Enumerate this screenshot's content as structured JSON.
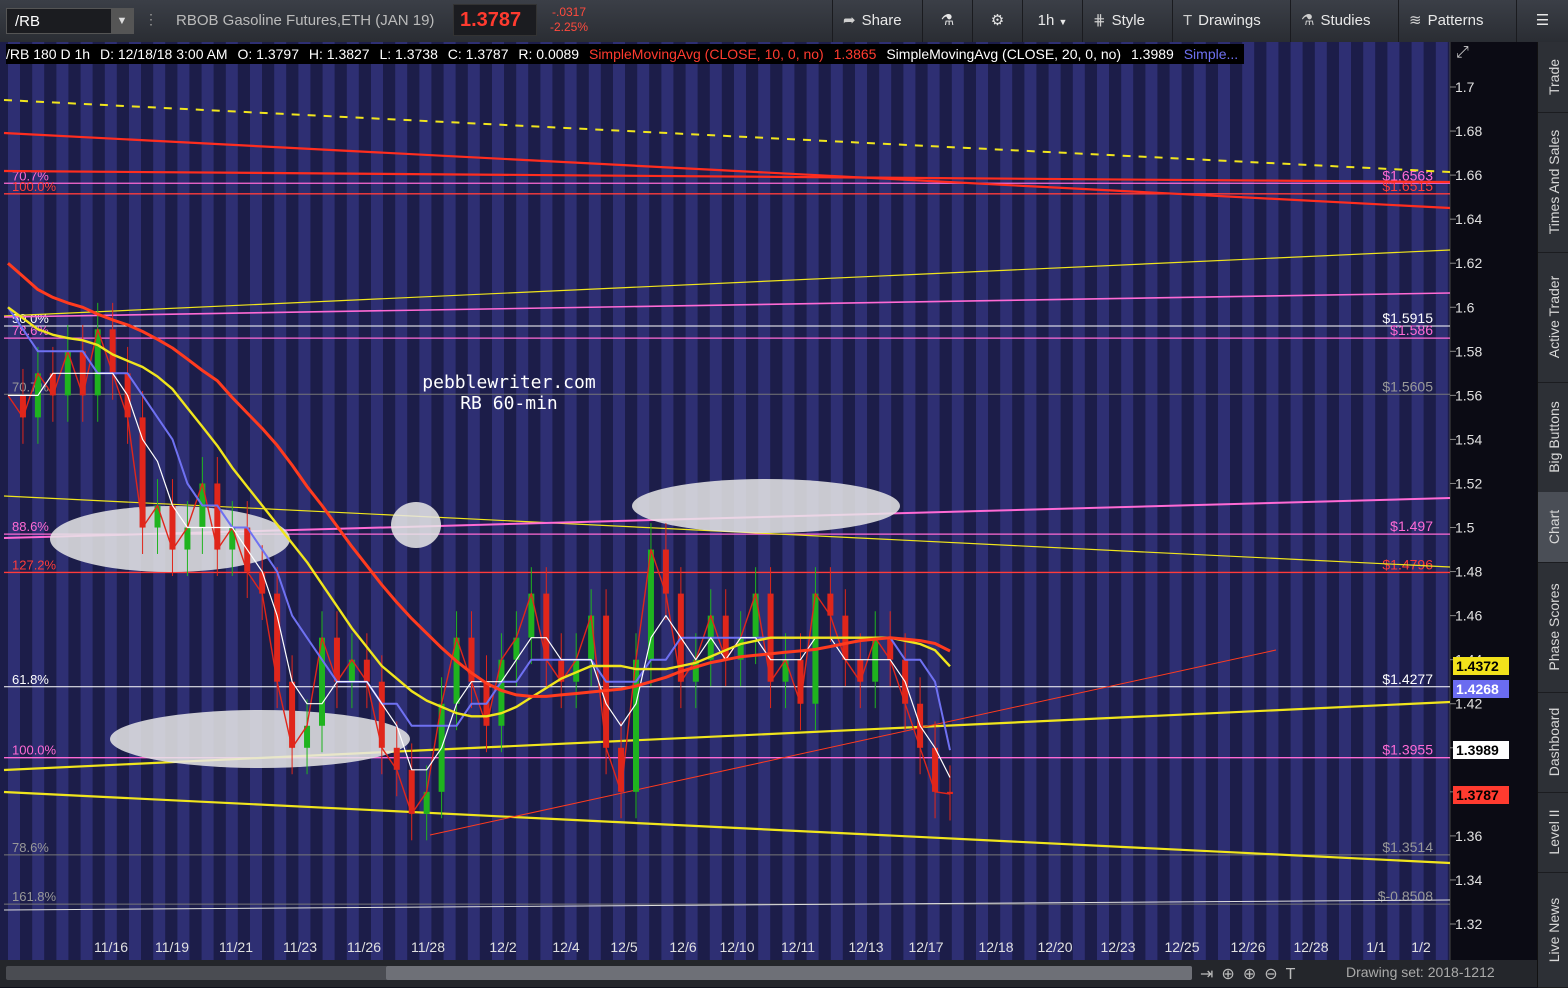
{
  "toolbar": {
    "symbol": "/RB",
    "description": "RBOB Gasoline Futures,ETH (JAN 19)",
    "last_price": "1.3787",
    "change": "-.0317",
    "change_pct": "-2.25%",
    "share": "Share",
    "timeframe": "1h",
    "style": "Style",
    "drawings": "Drawings",
    "studies": "Studies",
    "patterns": "Patterns"
  },
  "header": {
    "symbol_info": "/RB 180 D 1h",
    "date": "D: 12/18/18 3:00 AM",
    "open": "O: 1.3797",
    "high": "H: 1.3827",
    "low": "L: 1.3738",
    "close": "C: 1.3787",
    "range": "R: 0.0089",
    "sma10_label": "SimpleMovingAvg (CLOSE, 10, 0, no)",
    "sma10_value": "1.3865",
    "sma20_label": "SimpleMovingAvg (CLOSE, 20, 0, no)",
    "sma20_value": "1.3989",
    "more": "Simple..."
  },
  "watermark": {
    "line1": "pebblewriter.com",
    "line2": "RB 60-min"
  },
  "side_tabs": [
    "Trade",
    "Times And Sales",
    "Active Trader",
    "Big Buttons",
    "Chart",
    "Phase Scores",
    "Dashboard",
    "Level II",
    "Live News"
  ],
  "bottom": {
    "drawing_set": "Drawing set: 2018-1212"
  },
  "chart_data": {
    "type": "line",
    "ylim": [
      1.31,
      1.72
    ],
    "y_ticks": [
      "1.7",
      "1.68",
      "1.66",
      "1.64",
      "1.62",
      "1.6",
      "1.58",
      "1.56",
      "1.54",
      "1.52",
      "1.5",
      "1.48",
      "1.46",
      "1.44",
      "1.42",
      "1.4",
      "1.38",
      "1.36",
      "1.34",
      "1.32"
    ],
    "x_ticks": [
      "11/16",
      "11/19",
      "11/21",
      "11/23",
      "11/26",
      "11/28",
      "12/2",
      "12/4",
      "12/5",
      "12/6",
      "12/10",
      "12/11",
      "12/13",
      "12/17",
      "12/18",
      "12/20",
      "12/23",
      "12/25",
      "12/26",
      "12/28",
      "1/1",
      "1/2"
    ],
    "fib_levels": [
      {
        "left": "70.7%",
        "right": "$1.6563",
        "value": 1.6563,
        "color": "#ff6ad5"
      },
      {
        "left": "100.0%",
        "right": "$1.6515",
        "value": 1.6515,
        "color": "#ff3b3b"
      },
      {
        "left": "50.0%",
        "right": "$1.5915",
        "value": 1.5915,
        "color": "#ffffff"
      },
      {
        "left": "78.6%",
        "right": "$1.586",
        "value": 1.586,
        "color": "#ff6ad5"
      },
      {
        "left": "70.7%",
        "right": "$1.5605",
        "value": 1.5605,
        "color": "#777777"
      },
      {
        "left": "88.6%",
        "right": "$1.497",
        "value": 1.497,
        "color": "#ff6ad5"
      },
      {
        "left": "127.2%",
        "right": "$1.4796",
        "value": 1.4796,
        "color": "#ff3b3b"
      },
      {
        "left": "61.8%",
        "right": "$1.4277",
        "value": 1.4277,
        "color": "#ffffff"
      },
      {
        "left": "100.0%",
        "right": "$1.3955",
        "value": 1.3955,
        "color": "#ff6ad5"
      },
      {
        "left": "78.6%",
        "right": "$1.3514",
        "value": 1.3514,
        "color": "#777777"
      },
      {
        "left": "161.8%",
        "right": "$-0.8508",
        "value": 1.329,
        "color": "#777777"
      }
    ],
    "price_tags": [
      {
        "label": "1.4372",
        "value": 1.4372,
        "bg": "#f2e21b",
        "fg": "#000000"
      },
      {
        "label": "1.4268",
        "value": 1.4268,
        "bg": "#6b6cf0",
        "fg": "#ffffff"
      },
      {
        "label": "1.3989",
        "value": 1.3989,
        "bg": "#ffffff",
        "fg": "#000000"
      },
      {
        "label": "1.3787",
        "value": 1.3787,
        "bg": "#ff3b2f",
        "fg": "#000000"
      }
    ],
    "close_series": [
      1.56,
      1.55,
      1.57,
      1.56,
      1.58,
      1.56,
      1.59,
      1.57,
      1.55,
      1.5,
      1.51,
      1.49,
      1.5,
      1.52,
      1.49,
      1.5,
      1.48,
      1.47,
      1.43,
      1.4,
      1.41,
      1.45,
      1.43,
      1.44,
      1.43,
      1.4,
      1.39,
      1.37,
      1.38,
      1.42,
      1.45,
      1.43,
      1.41,
      1.44,
      1.45,
      1.47,
      1.44,
      1.43,
      1.44,
      1.46,
      1.4,
      1.38,
      1.44,
      1.49,
      1.47,
      1.43,
      1.44,
      1.46,
      1.44,
      1.45,
      1.47,
      1.43,
      1.44,
      1.42,
      1.47,
      1.46,
      1.44,
      1.43,
      1.45,
      1.44,
      1.42,
      1.4,
      1.38,
      1.379
    ],
    "sma10_series": [
      1.56,
      1.56,
      1.56,
      1.57,
      1.57,
      1.57,
      1.57,
      1.57,
      1.56,
      1.54,
      1.53,
      1.51,
      1.5,
      1.5,
      1.5,
      1.5,
      1.49,
      1.48,
      1.46,
      1.43,
      1.42,
      1.42,
      1.43,
      1.43,
      1.43,
      1.42,
      1.41,
      1.39,
      1.39,
      1.4,
      1.42,
      1.43,
      1.43,
      1.43,
      1.44,
      1.45,
      1.45,
      1.44,
      1.44,
      1.44,
      1.42,
      1.41,
      1.42,
      1.45,
      1.46,
      1.45,
      1.44,
      1.45,
      1.44,
      1.45,
      1.45,
      1.44,
      1.44,
      1.44,
      1.45,
      1.45,
      1.44,
      1.44,
      1.44,
      1.44,
      1.43,
      1.41,
      1.4,
      1.3865
    ],
    "sma20_series": [
      1.6,
      1.59,
      1.58,
      1.58,
      1.58,
      1.58,
      1.57,
      1.57,
      1.57,
      1.56,
      1.55,
      1.54,
      1.52,
      1.51,
      1.51,
      1.5,
      1.5,
      1.49,
      1.48,
      1.46,
      1.45,
      1.44,
      1.43,
      1.43,
      1.43,
      1.42,
      1.42,
      1.41,
      1.41,
      1.41,
      1.41,
      1.42,
      1.42,
      1.43,
      1.43,
      1.44,
      1.44,
      1.44,
      1.44,
      1.44,
      1.43,
      1.43,
      1.43,
      1.44,
      1.44,
      1.45,
      1.45,
      1.45,
      1.45,
      1.45,
      1.45,
      1.45,
      1.45,
      1.45,
      1.45,
      1.45,
      1.45,
      1.45,
      1.45,
      1.45,
      1.44,
      1.44,
      1.43,
      1.3989
    ]
  },
  "colors": {
    "price": "#e0261b",
    "sma10": "#ffffff",
    "sma20": "#6f71f2",
    "sma_yellow": "#f0e51d",
    "sma_red": "#ff3b1f",
    "bull": "#1fb31f"
  }
}
